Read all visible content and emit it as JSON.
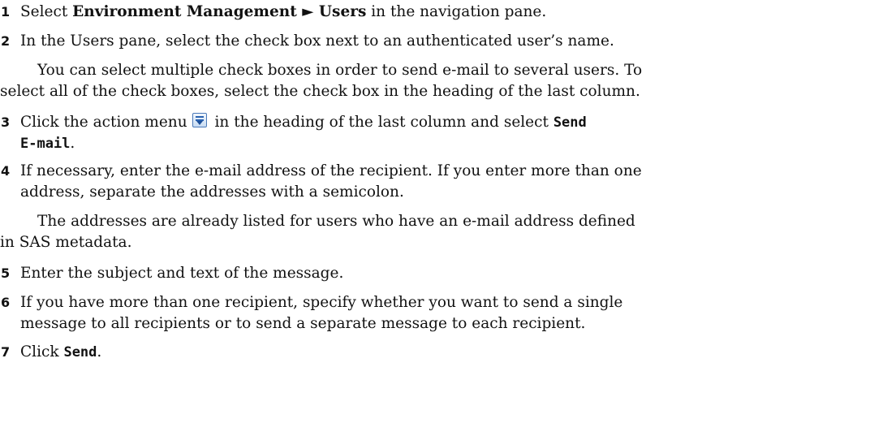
{
  "steps": [
    {
      "num": "1",
      "t1": "Select ",
      "b1": "Environment Management",
      "arrow": " ► ",
      "b2": "Users",
      "t2": " in the navigation pane."
    },
    {
      "num": "2",
      "text": "In the Users pane, select the check box next to an authenticated user’s name."
    },
    {
      "num": "3",
      "t1": "Click the action menu",
      "t2": " in the heading of the last column and select ",
      "cmd_line1": "Send",
      "cmd_line2": "E-mail",
      "t3": "."
    },
    {
      "num": "4",
      "line1": "If necessary, enter the e-mail address of the recipient. If you enter more than one",
      "line2": "address, separate the addresses with a semicolon."
    },
    {
      "num": "5",
      "text": "Enter the subject and text of the message."
    },
    {
      "num": "6",
      "line1": "If you have more than one recipient, specify whether you want to send a single",
      "line2": "message to all recipients or to send a separate message to each recipient."
    },
    {
      "num": "7",
      "t1": "Click ",
      "cmd": "Send",
      "t2": "."
    }
  ],
  "notes": [
    {
      "line1": "You can select multiple check boxes in order to send e-mail to several users. To",
      "line2": "select all of the check boxes, select the check box in the heading of the last column."
    },
    {
      "line1": "The addresses are already listed for users who have an e-mail address defined",
      "line2": "in SAS metadata."
    }
  ],
  "icons": {
    "action_menu": "action-menu-icon"
  }
}
